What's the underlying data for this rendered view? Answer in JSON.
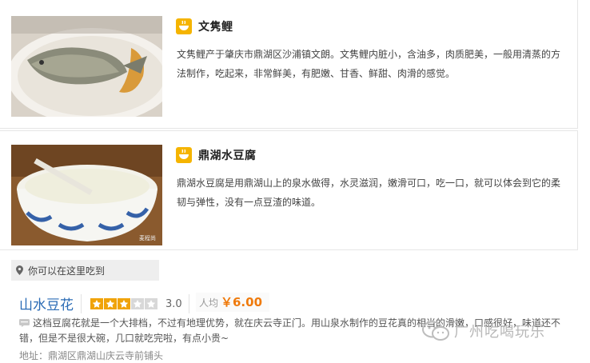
{
  "dishes": [
    {
      "title": "文隽鲤",
      "description": "文隽鲤产于肇庆市鼎湖区沙浦镇文朗。文隽鲤内脏小，含油多，肉质肥美，一般用清蒸的方法制作，吃起来，非常鲜美，有肥嫩、甘香、鲜甜、肉滑的感觉。",
      "image": "steamed-carp-photo"
    },
    {
      "title": "鼎湖水豆腐",
      "description": "鼎湖水豆腐是用鼎湖山上的泉水做得，水灵滋润，嫩滑可口，吃一口，就可以体会到它的柔韧与弹性，没有一点豆渣的味道。",
      "image": "tofu-pudding-photo",
      "image_caption": "麦程尚"
    }
  ],
  "eat_here_label": "你可以在这里吃到",
  "shop": {
    "name": "山水豆花",
    "rating": 3,
    "rating_max": 5,
    "score": "3.0",
    "avg_label": "人均",
    "avg_price": "￥6.00",
    "review": "这档豆腐花就是一个大排档，不过有地理优势，就在庆云寺正门。用山泉水制作的豆花真的相当的滑嫩，口感很好，味道还不错，但是不是很大碗，几口就吃完啦，有点小贵~",
    "address": "地址：鼎湖区鼎湖山庆云寺前铺头"
  },
  "watermark": "广州吃喝玩乐",
  "colors": {
    "icon_yellow": "#f5b400",
    "star_gold": "#f0a30a",
    "link_blue": "#2a6bb5",
    "price_orange": "#ef7a0c"
  }
}
